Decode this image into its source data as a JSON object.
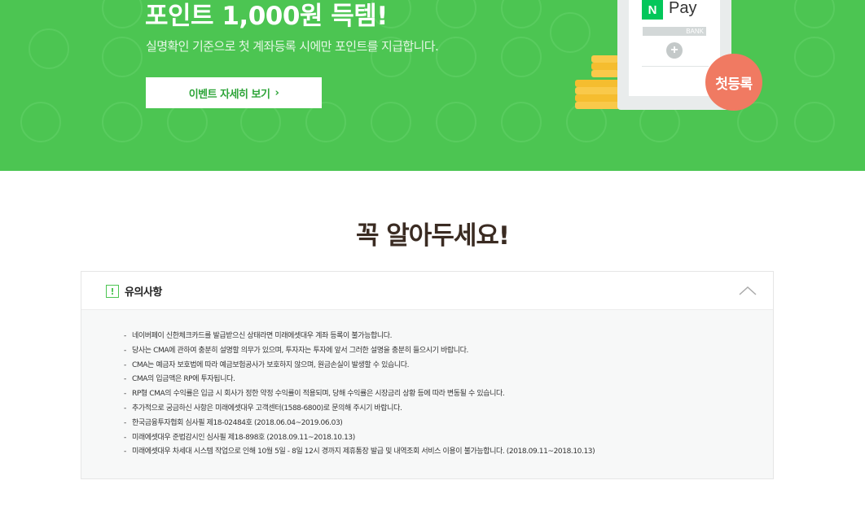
{
  "hero": {
    "title": "포인트 1,000원 득템!",
    "subtitle": "실명확인 기준으로 첫 계좌등록 시에만 포인트를 지급합니다.",
    "button_label": "이벤트 자세히 보기",
    "button_chevron": "›",
    "background_color": "#4cc552"
  },
  "illustration": {
    "npay_badge": "N",
    "npay_text": "Pay",
    "bank_label": "BANK",
    "plus": "+",
    "first_badge": "첫등록",
    "badge_color": "#f07a62"
  },
  "notice": {
    "section_title": "꼭 알아두세요!",
    "panel_icon": "!",
    "panel_title": "유의사항",
    "items": [
      "네이버페이 신한체크카드를 발급받으신 상태라면 미래에셋대우 계좌 등록이 불가능합니다.",
      "당사는 CMA에 관하여 충분히 설명할 의무가 있으며, 투자자는 투자에 앞서 그러한 설명을 충분히 들으시기 바랍니다.",
      "CMA는 예금자 보호법에 따라 예금보험공사가 보호하지 않으며, 원금손실이 발생할 수 있습니다.",
      "CMA의 입금액은 RP에 투자됩니다.",
      "RP형 CMA의 수익률은 입금 시 회사가 정한 약정 수익률이 적용되며, 당해 수익률은 시장금리 상황 등에 따라 변동될 수 있습니다.",
      "추가적으로 궁금하신 사항은 미래에셋대우 고객센터(1588-6800)로 문의해 주시기 바랍니다.",
      "한국금융투자협회 심사필 제18-02484호 (2018.06.04~2019.06.03)",
      "미래에셋대우 준법감시인 심사필 제18-898호 (2018.09.11~2018.10.13)",
      "미래에셋대우 차세대 시스템 작업으로 인해 10월 5일 - 8일 12시 경까지 제휴통장 발급 및 내역조회 서비스 이용이 불가능합니다. (2018.09.11~2018.10.13)"
    ]
  }
}
